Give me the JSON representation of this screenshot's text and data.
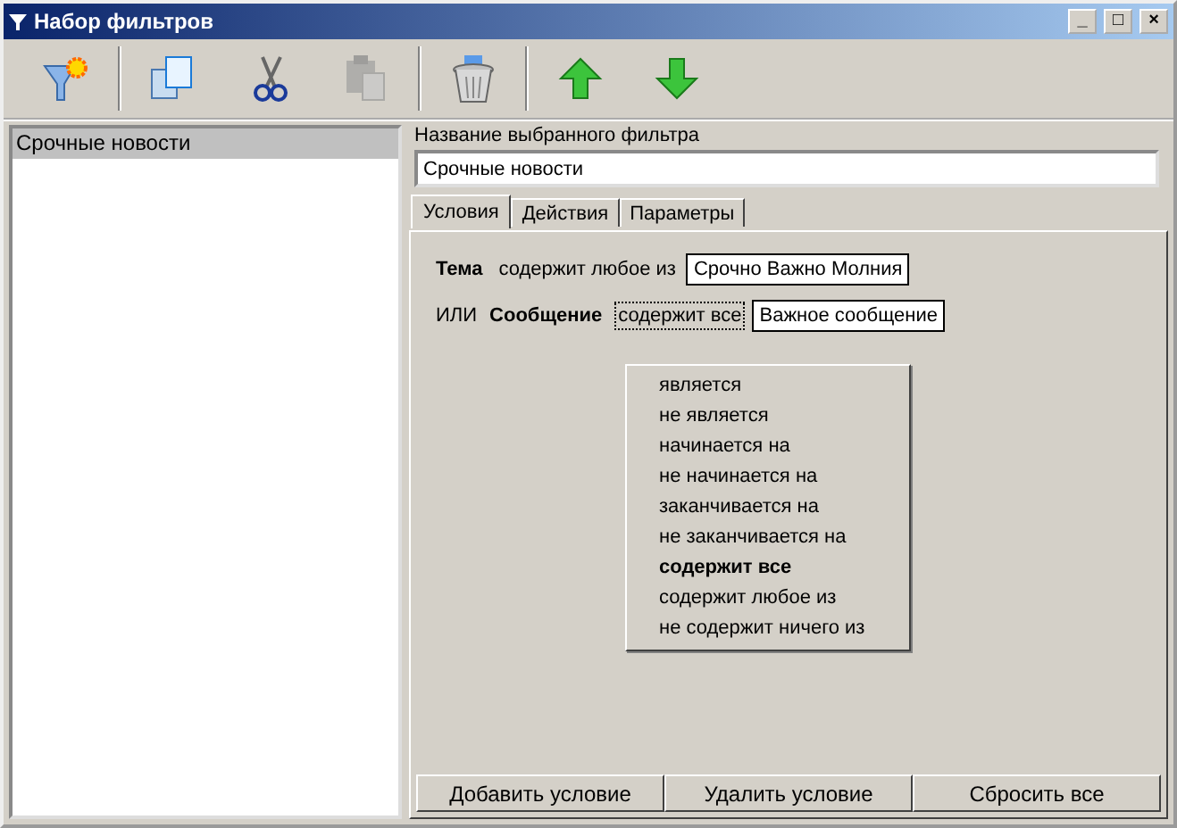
{
  "window": {
    "title": "Набор фильтров",
    "controls": [
      "_",
      "□",
      "×"
    ]
  },
  "toolbar": [
    {
      "kind": "new-filter",
      "disabled": false
    },
    {
      "kind": "copy",
      "disabled": false
    },
    {
      "kind": "cut",
      "disabled": false
    },
    {
      "kind": "paste",
      "disabled": true
    },
    {
      "kind": "delete",
      "disabled": false
    },
    {
      "kind": "up",
      "disabled": false
    },
    {
      "kind": "down",
      "disabled": false
    }
  ],
  "filters": [
    {
      "label": "Срочные новости",
      "selected": true
    }
  ],
  "name_field": {
    "label": "Название выбранного фильтра",
    "value": "Срочные новости"
  },
  "tabs": [
    {
      "label": "Условия",
      "selected": true
    },
    {
      "label": "Действия",
      "selected": false
    },
    {
      "label": "Параметры",
      "selected": false
    }
  ],
  "conditions": [
    {
      "field": "Тема",
      "operator": "содержит любое из",
      "value": "Срочно Важно Молния",
      "focused": false
    },
    {
      "connector": "ИЛИ",
      "field": "Сообщение",
      "operator": "содержит все",
      "value": "Важное сообщение",
      "focused": true
    }
  ],
  "operator_menu": [
    {
      "label": "является",
      "selected": false
    },
    {
      "label": "не является",
      "selected": false
    },
    {
      "label": "начинается на",
      "selected": false
    },
    {
      "label": "не начинается на",
      "selected": false
    },
    {
      "label": "заканчивается на",
      "selected": false
    },
    {
      "label": "не заканчивается на",
      "selected": false
    },
    {
      "label": "содержит все",
      "selected": true
    },
    {
      "label": "содержит любое из",
      "selected": false
    },
    {
      "label": "не содержит ничего из",
      "selected": false
    }
  ],
  "buttons": [
    "Добавить условие",
    "Удалить условие",
    "Сбросить все"
  ]
}
